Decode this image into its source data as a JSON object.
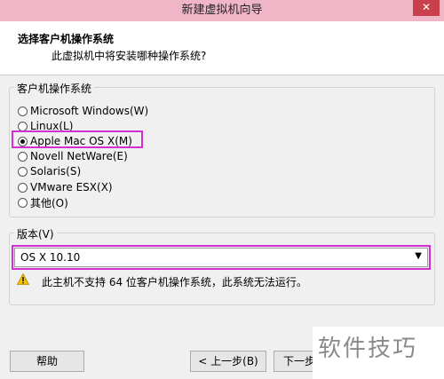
{
  "window": {
    "title": "新建虚拟机向导",
    "close_glyph": "✕"
  },
  "header": {
    "title": "选择客户机操作系统",
    "subtitle": "此虚拟机中将安装哪种操作系统?"
  },
  "guest_os": {
    "group_label": "客户机操作系统",
    "options": [
      {
        "label": "Microsoft Windows(W)",
        "selected": false
      },
      {
        "label": "Linux(L)",
        "selected": false
      },
      {
        "label": "Apple Mac OS X(M)",
        "selected": true
      },
      {
        "label": "Novell NetWare(E)",
        "selected": false
      },
      {
        "label": "Solaris(S)",
        "selected": false
      },
      {
        "label": "VMware ESX(X)",
        "selected": false
      },
      {
        "label": "其他(O)",
        "selected": false
      }
    ]
  },
  "version": {
    "group_label": "版本(V)",
    "selected": "OS X 10.10",
    "warning": "此主机不支持 64 位客户机操作系统，此系统无法运行。"
  },
  "buttons": {
    "help": "帮助",
    "back": "< 上一步(B)",
    "next": "下一步"
  },
  "watermark": "软件技巧",
  "colors": {
    "highlight": "#d12fd1",
    "titlebar": "#f0b6c8",
    "close": "#c9404c"
  }
}
